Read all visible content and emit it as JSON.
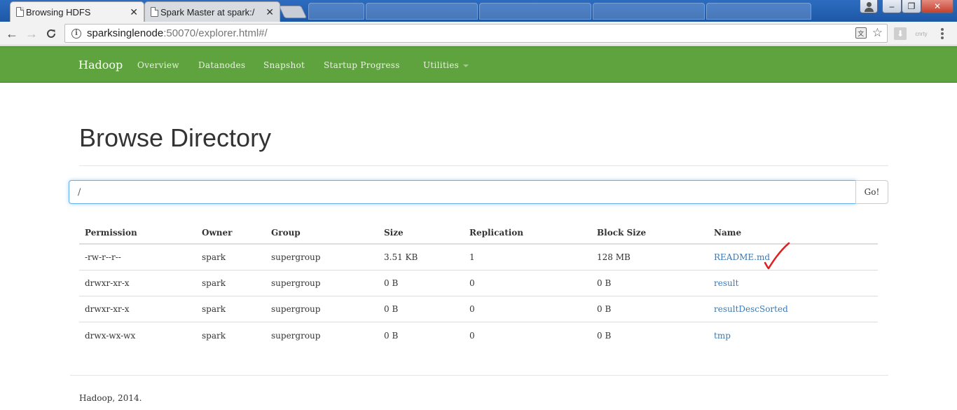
{
  "browser": {
    "tabs": [
      {
        "title": "Browsing HDFS",
        "active": true
      },
      {
        "title": "Spark Master at spark:/",
        "active": false
      }
    ],
    "url": {
      "host": "sparksinglenode",
      "rest": ":50070/explorer.html#/"
    },
    "ext2_label": "cnrty",
    "window_buttons": {
      "minimize": "–",
      "maximize": "❐",
      "close": "✕"
    }
  },
  "navbar": {
    "brand": "Hadoop",
    "items": [
      "Overview",
      "Datanodes",
      "Snapshot",
      "Startup Progress",
      "Utilities"
    ]
  },
  "page": {
    "title": "Browse Directory",
    "path_value": "/",
    "go_label": "Go!"
  },
  "table": {
    "headers": [
      "Permission",
      "Owner",
      "Group",
      "Size",
      "Replication",
      "Block Size",
      "Name"
    ],
    "rows": [
      [
        "-rw-r--r--",
        "spark",
        "supergroup",
        "3.51 KB",
        "1",
        "128 MB",
        "README.md"
      ],
      [
        "drwxr-xr-x",
        "spark",
        "supergroup",
        "0 B",
        "0",
        "0 B",
        "result"
      ],
      [
        "drwxr-xr-x",
        "spark",
        "supergroup",
        "0 B",
        "0",
        "0 B",
        "resultDescSorted"
      ],
      [
        "drwx-wx-wx",
        "spark",
        "supergroup",
        "0 B",
        "0",
        "0 B",
        "tmp"
      ]
    ]
  },
  "footer": {
    "text": "Hadoop, 2014."
  },
  "colors": {
    "navbar": "#5fa33e",
    "link": "#3a7ab5",
    "annotation": "#e02020"
  }
}
